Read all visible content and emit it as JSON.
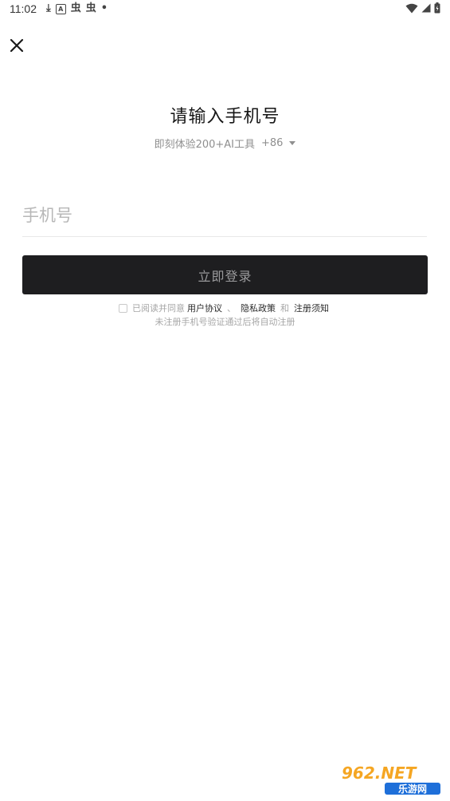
{
  "status_bar": {
    "time": "11:02",
    "notification_glyphs": [
      "⤓",
      "A",
      "虫",
      "虫",
      "•"
    ],
    "icons": [
      "download-icon",
      "a-box-icon",
      "bug-icon",
      "bug-icon",
      "dot-icon",
      "wifi-icon",
      "signal-icon",
      "battery-icon"
    ]
  },
  "header": {
    "close_icon": "close-icon"
  },
  "login": {
    "title": "请输入手机号",
    "subtitle": "即刻体验200+AI工具",
    "country_code": "+86",
    "phone_placeholder": "手机号",
    "phone_value": "",
    "login_label": "立即登录"
  },
  "agreement": {
    "prefix": "已阅读并同意",
    "user_agreement": "用户协议",
    "separator": "、",
    "privacy_policy": "隐私政策",
    "and": "和",
    "register_notice": "注册须知",
    "hint": "未注册手机号验证通过后将自动注册"
  },
  "watermark": {
    "text_top": "962.NET",
    "text_bottom": "乐游网"
  },
  "colors": {
    "button_bg": "#1e1e20",
    "button_text": "#9a9a9c",
    "watermark_orange": "#f5a623",
    "watermark_blue": "#1e6fd9"
  }
}
